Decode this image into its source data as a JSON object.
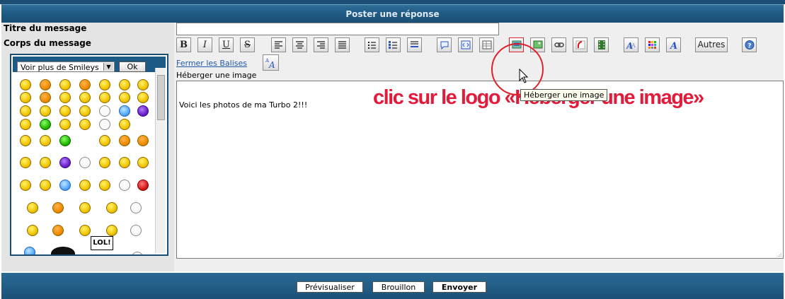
{
  "header": {
    "title": "Poster une réponse"
  },
  "form": {
    "title_label": "Titre du message",
    "title_value": "",
    "body_label": "Corps du message",
    "body_text": "Voici les photos de ma Turbo 2!!!"
  },
  "toolbar": {
    "buttons": [
      "bold",
      "italic",
      "underline",
      "strikethrough",
      "align-left",
      "align-center",
      "align-right",
      "align-justify",
      "bullet-list",
      "numbered-list",
      "horizontal-rule",
      "quote",
      "code",
      "table",
      "host-image",
      "image",
      "link",
      "flash",
      "video",
      "font-size",
      "color",
      "font",
      "others",
      "help"
    ],
    "bold_label": "B",
    "italic_label": "I",
    "underline_label": "U",
    "strike_label": "S",
    "others_label": "Autres",
    "fermer_balises": "Fermer les Balises",
    "heberger_label": "Héberger une image",
    "tooltip": "Héberger une image"
  },
  "annotation": {
    "text": "clic sur le logo «Héberger une image»",
    "color": "#e31b3b"
  },
  "smileys": {
    "select_value": "Voir plus de Smileys",
    "ok_label": "Ok",
    "lol_sign": "LOL!"
  },
  "footer": {
    "preview_label": "Prévisualiser",
    "draft_label": "Brouillon",
    "send_label": "Envoyer"
  }
}
